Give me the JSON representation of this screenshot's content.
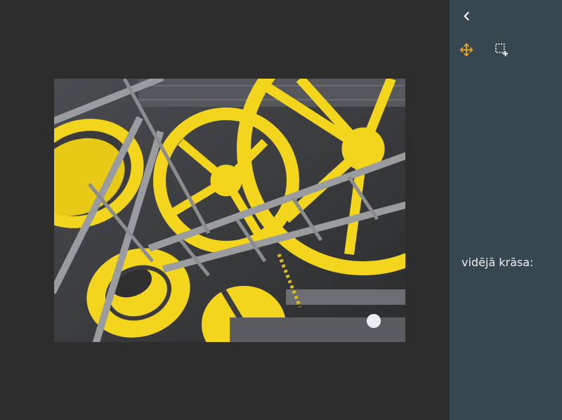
{
  "photo": {
    "description_icon": "yellow-wheels-machinery-photo"
  },
  "side_panel": {
    "back_icon": "chevron-left-icon",
    "tools": [
      {
        "icon": "move-arrows-icon",
        "color": "#f0a32a",
        "active": true
      },
      {
        "icon": "select-region-add-icon",
        "color": "#ffffff",
        "active": false
      }
    ],
    "average_color_label": "vidējā krāsa:"
  },
  "colors": {
    "canvas_bg": "#2d2d2d",
    "panel_bg": "#37474f",
    "accent": "#f0a32a",
    "wheel_yellow": "#f2d51c"
  }
}
